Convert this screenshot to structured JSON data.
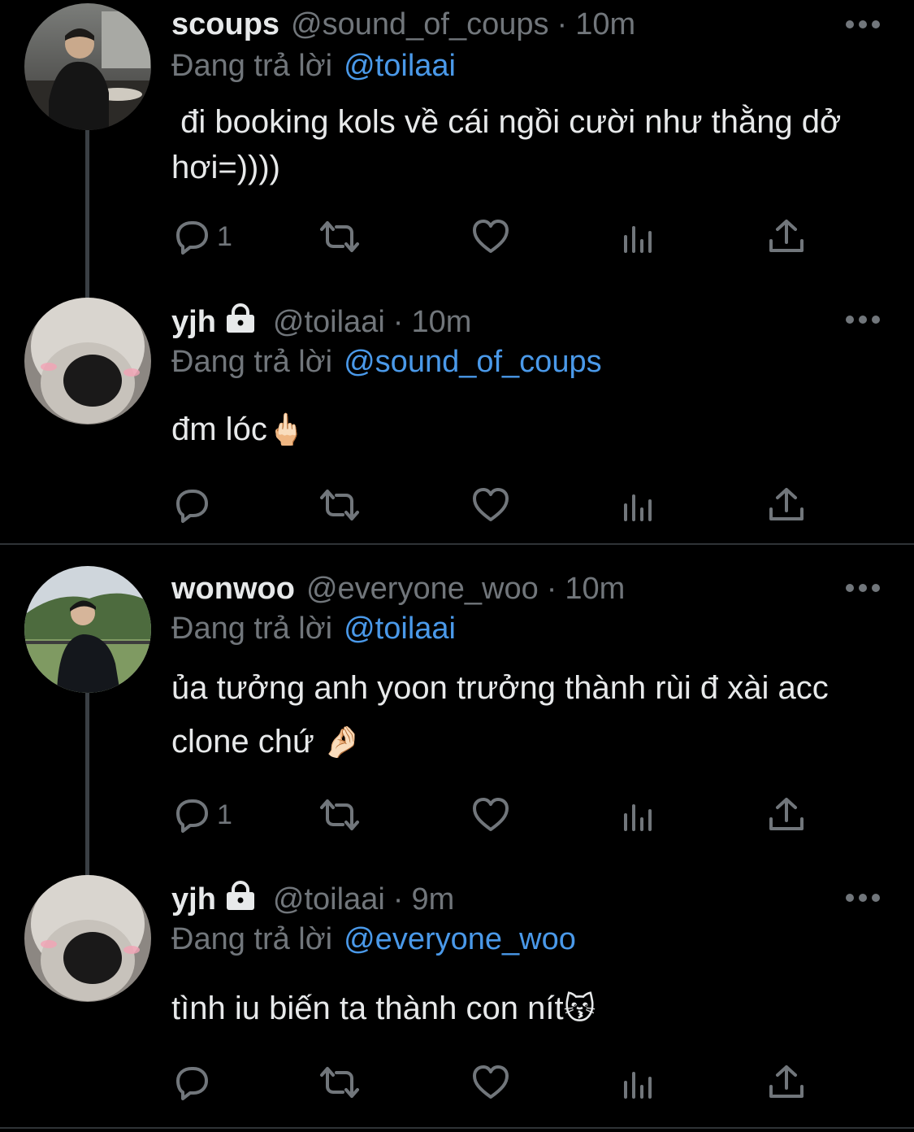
{
  "tweets": [
    {
      "name": "scoups",
      "locked": false,
      "handle": "@sound_of_coups",
      "sep": "·",
      "time": "10m",
      "reply_prefix": "Đang trả lời",
      "reply_to": "@toilaai",
      "text": " đi booking kols về cái ngồi cười như thằng dở hơi=))))",
      "emoji": "",
      "reply_count": "1",
      "avatar": "photo-man-restaurant"
    },
    {
      "name": "yjh",
      "locked": true,
      "handle": "@toilaai",
      "sep": "·",
      "time": "10m",
      "reply_prefix": "Đang trả lời",
      "reply_to": "@sound_of_coups",
      "text": "đm lóc",
      "emoji": "🖕🏻",
      "reply_count": "",
      "avatar": "photo-seal-closeup"
    },
    {
      "name": "wonwoo",
      "locked": false,
      "handle": "@everyone_woo",
      "sep": "·",
      "time": "10m",
      "reply_prefix": "Đang trả lời",
      "reply_to": "@toilaai",
      "text": "ủa tưởng anh yoon trưởng thành rùi đ xài acc clone chứ ",
      "emoji": "🤌🏻",
      "reply_count": "1",
      "avatar": "photo-man-outdoors"
    },
    {
      "name": "yjh",
      "locked": true,
      "handle": "@toilaai",
      "sep": "·",
      "time": "9m",
      "reply_prefix": "Đang trả lời",
      "reply_to": "@everyone_woo",
      "text": "tình iu biến ta thành con nít",
      "emoji": "😽",
      "reply_count": "",
      "avatar": "photo-seal-closeup"
    }
  ],
  "icons": {
    "reply": "speech-bubble-icon",
    "retweet": "retweet-icon",
    "like": "heart-icon",
    "views": "bar-chart-icon",
    "share": "share-upload-icon",
    "more": "more-dots-icon",
    "lock": "lock-icon"
  },
  "colors": {
    "background": "#000000",
    "text": "#e7e9ea",
    "muted": "#71767b",
    "mention": "#4a99e9",
    "divider": "#2f3336"
  }
}
